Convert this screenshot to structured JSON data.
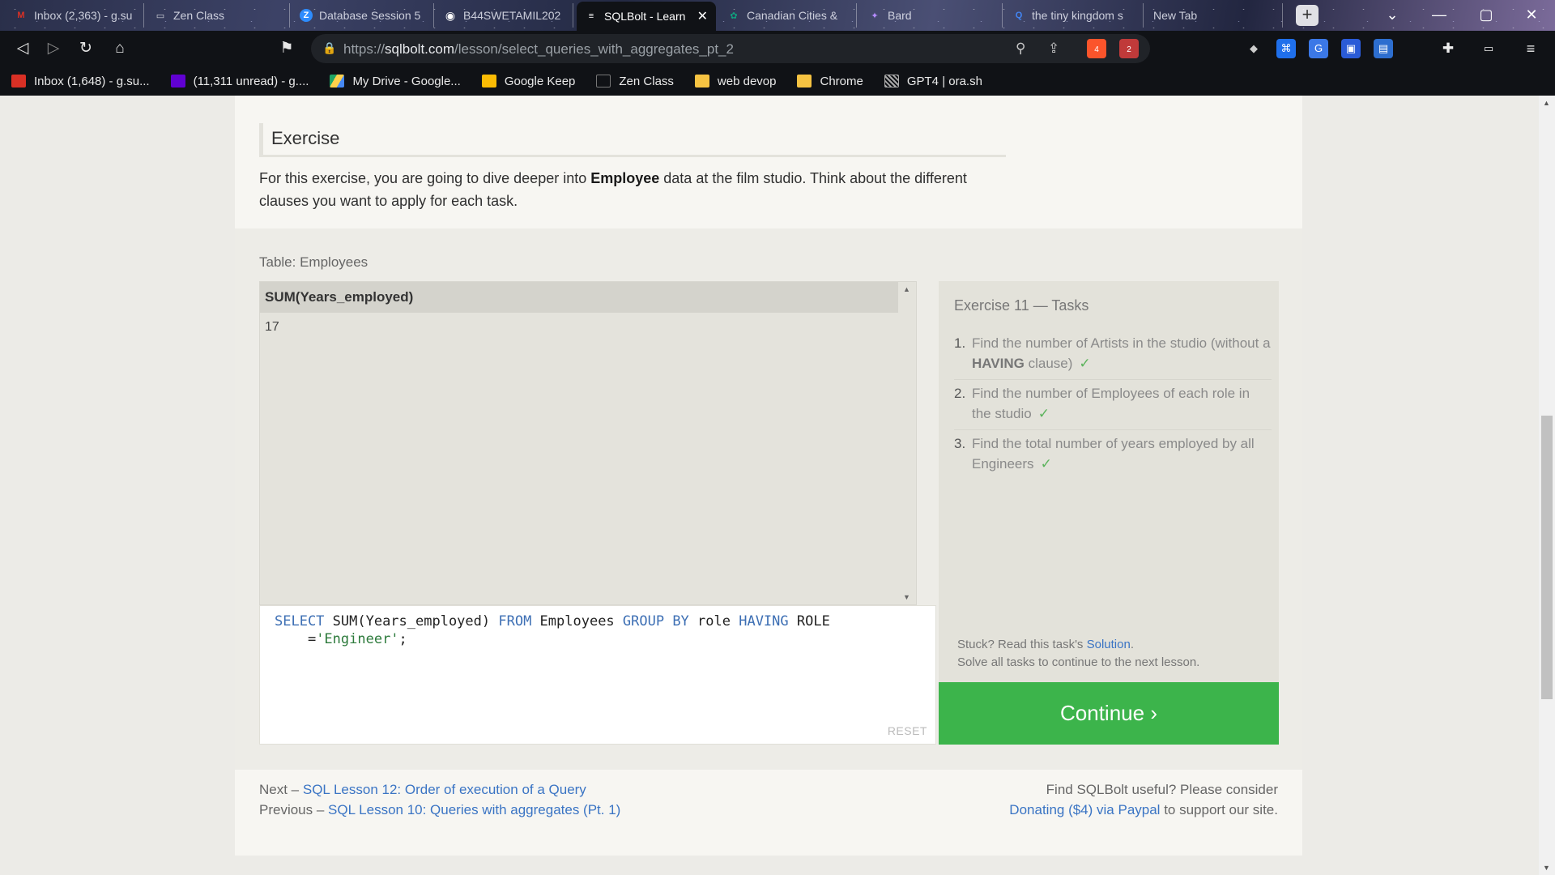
{
  "browser": {
    "tabs": [
      {
        "label": "Inbox (2,363) - g.su",
        "icon_color": "#d93025",
        "icon_glyph": "M"
      },
      {
        "label": "Zen Class",
        "icon_color": "#555a66",
        "icon_glyph": "▭"
      },
      {
        "label": "Database Session 5",
        "icon_color": "#2d8cff",
        "icon_glyph": "Z"
      },
      {
        "label": "B44SWETAMIL202",
        "icon_color": "#24292e",
        "icon_glyph": "◉"
      },
      {
        "label": "SQLBolt - Learn",
        "icon_color": "#101216",
        "icon_glyph": "≡"
      },
      {
        "label": "Canadian Cities &",
        "icon_color": "#10a37f",
        "icon_glyph": "✿"
      },
      {
        "label": "Bard",
        "icon_color": "#7a5af8",
        "icon_glyph": "✦"
      },
      {
        "label": "the tiny kingdom s",
        "icon_color": "#4285f4",
        "icon_glyph": "Q"
      },
      {
        "label": "New Tab",
        "icon_color": "transparent",
        "icon_glyph": ""
      }
    ],
    "active_tab_close": "✕",
    "new_tab": "+",
    "window_controls": {
      "dropdown": "⌄",
      "minimize": "—",
      "maximize": "▢",
      "close": "✕"
    },
    "url_scheme": "https://",
    "url_host": "sqlbolt.com",
    "url_path": "/lesson/select_queries_with_aggregates_pt_2",
    "brave_badge": "4",
    "alert_badge": "2",
    "bookmarks": [
      {
        "label": "Inbox (1,648) - g.su...",
        "icon_color": "#d93025"
      },
      {
        "label": "(11,311 unread) - g....",
        "icon_color": "#6001d2"
      },
      {
        "label": "My Drive - Google...",
        "icon_color": "#1fa463"
      },
      {
        "label": "Google Keep",
        "icon_color": "#fbbc04"
      },
      {
        "label": "Zen Class",
        "icon_color": "#555a66"
      },
      {
        "label": "web devop",
        "icon_color": "#f6c342"
      },
      {
        "label": "Chrome",
        "icon_color": "#f6c342"
      },
      {
        "label": "GPT4 | ora.sh",
        "icon_color": "#888888"
      }
    ]
  },
  "page": {
    "exercise_heading": "Exercise",
    "intro_before": "For this exercise, you are going to dive deeper into ",
    "intro_bold": "Employee",
    "intro_after": " data at the film studio. Think about the different clauses you want to apply for each task.",
    "table_label": "Table: Employees",
    "result": {
      "columns": [
        "SUM(Years_employed)"
      ],
      "rows": [
        [
          "17"
        ]
      ]
    },
    "query": {
      "line1_kw1": "SELECT",
      "line1_a": " SUM(Years_employed) ",
      "line1_kw2": "FROM",
      "line1_b": " Employees ",
      "line1_kw3": "GROUP BY",
      "line1_c": " role ",
      "line1_kw4": "HAVING",
      "line1_d": " ROLE",
      "line2_a": "    =",
      "line2_str": "'Engineer'",
      "line2_b": ";"
    },
    "reset_label": "RESET",
    "tasks_title": "Exercise 11 — Tasks",
    "tasks": [
      {
        "num": "1.",
        "text_before": "Find the number of Artists in the studio (without a ",
        "bold": "HAVING",
        "text_after": " clause)",
        "check": "✓"
      },
      {
        "num": "2.",
        "text_before": "Find the number of Employees of each role in the studio",
        "bold": "",
        "text_after": "",
        "check": "✓"
      },
      {
        "num": "3.",
        "text_before": "Find the total number of years employed by all Engineers",
        "bold": "",
        "text_after": "",
        "check": "✓"
      }
    ],
    "stuck_before": "Stuck? Read this task's ",
    "stuck_link": "Solution",
    "stuck_after": ".",
    "solve_all": "Solve all tasks to continue to the next lesson.",
    "continue_label": "Continue ›",
    "footer": {
      "next_prefix": "Next – ",
      "next_link": "SQL Lesson 12: Order of execution of a Query",
      "prev_prefix": "Previous – ",
      "prev_link": "SQL Lesson 10: Queries with aggregates (Pt. 1)",
      "useful": "Find SQLBolt useful? Please consider",
      "donate_link": "Donating ($4) via Paypal",
      "donate_after": " to support our site."
    }
  }
}
